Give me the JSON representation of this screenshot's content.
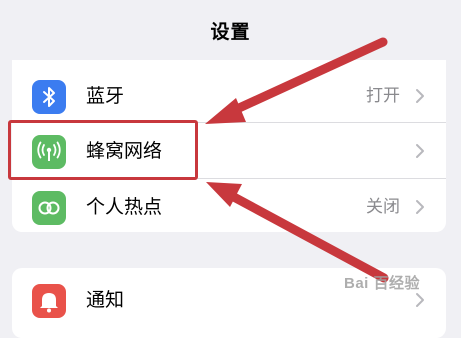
{
  "header": {
    "title": "设置"
  },
  "settings_top": [
    {
      "label": "蓝牙",
      "value": "打开",
      "icon": "bluetooth-icon",
      "icon_color": "#3b7cf0"
    },
    {
      "label": "蜂窝网络",
      "value": "",
      "icon": "antenna-icon",
      "icon_color": "#5dbb63"
    },
    {
      "label": "个人热点",
      "value": "关闭",
      "icon": "personal-hotspot-icon",
      "icon_color": "#5dbb63"
    }
  ],
  "settings_bottom": [
    {
      "label": "通知",
      "value": "",
      "icon": "bell-icon",
      "icon_color": "#e9524a"
    }
  ],
  "annotation": {
    "color": "#c8383d"
  },
  "watermark": {
    "text": "Bai  百经验"
  }
}
